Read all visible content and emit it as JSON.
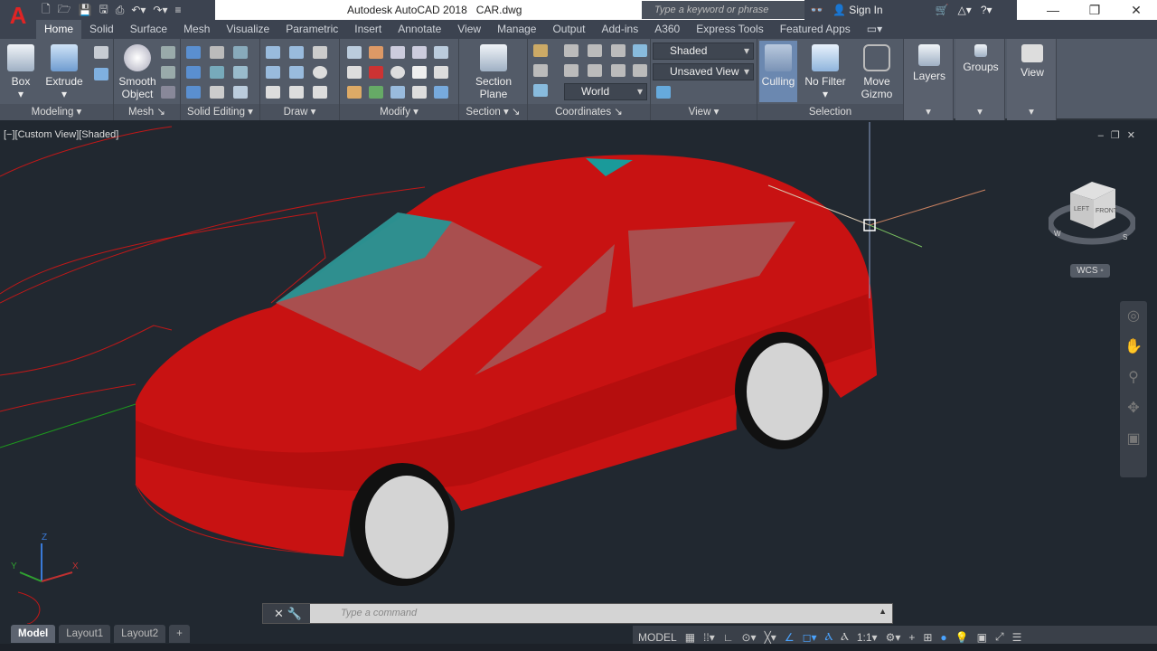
{
  "app": {
    "title": "Autodesk AutoCAD 2018",
    "file": "CAR.dwg",
    "logo": "A"
  },
  "search": {
    "placeholder": "Type a keyword or phrase"
  },
  "account": {
    "sign_in": "Sign In"
  },
  "tabs": [
    "Home",
    "Solid",
    "Surface",
    "Mesh",
    "Visualize",
    "Parametric",
    "Insert",
    "Annotate",
    "View",
    "Manage",
    "Output",
    "Add-ins",
    "A360",
    "Express Tools",
    "Featured Apps"
  ],
  "ribbon": {
    "modeling": {
      "label": "Modeling",
      "box": "Box",
      "extrude": "Extrude"
    },
    "mesh": {
      "label": "Mesh",
      "smooth": "Smooth",
      "object": "Object"
    },
    "solid_editing": {
      "label": "Solid Editing"
    },
    "draw": {
      "label": "Draw"
    },
    "modify": {
      "label": "Modify"
    },
    "section": {
      "label": "Section",
      "section": "Section",
      "plane": "Plane"
    },
    "coordinates": {
      "label": "Coordinates",
      "ucs": "World"
    },
    "view": {
      "label": "View",
      "visual_style": "Shaded",
      "named_view": "Unsaved View"
    },
    "selection": {
      "label": "Selection",
      "culling": "Culling",
      "no_filter": "No Filter",
      "move": "Move",
      "gizmo": "Gizmo"
    },
    "layers": "Layers",
    "groups": "Groups",
    "view_btn": "View"
  },
  "viewport": {
    "label": "[−][Custom View][Shaded]",
    "viewcube_left": "LEFT",
    "viewcube_front": "FRONT",
    "wcs": "WCS",
    "compass": {
      "w": "W",
      "s": "S"
    }
  },
  "ucs_icon": {
    "x": "X",
    "y": "Y",
    "z": "Z"
  },
  "command": {
    "placeholder": "Type a command"
  },
  "layout_tabs": [
    "Model",
    "Layout1",
    "Layout2",
    "+"
  ],
  "status": {
    "model": "MODEL",
    "scale": "1:1"
  },
  "colors": {
    "car": "#cc1010",
    "glass": "#1a9a9a",
    "viewport": "#212830"
  }
}
